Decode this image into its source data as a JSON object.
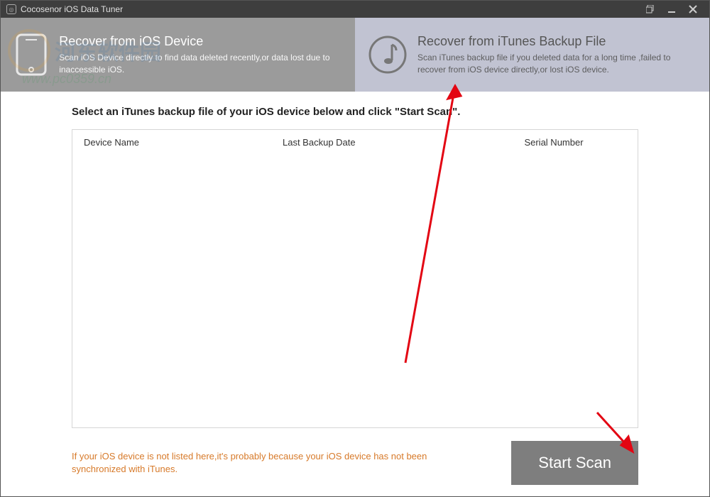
{
  "titlebar": {
    "title": "Cocosenor iOS Data Tuner"
  },
  "tabs": {
    "device": {
      "title": "Recover from iOS Device",
      "desc": "Scan iOS Device directly to find data deleted recently,or data lost due to inaccessible iOS."
    },
    "itunes": {
      "title": "Recover from iTunes Backup File",
      "desc": "Scan iTunes backup file if you deleted data for a long time ,failed to recover from iOS device directly,or lost iOS device."
    }
  },
  "instruction": "Select an iTunes backup file of your iOS device below and click \"Start Scan\".",
  "columns": {
    "name": "Device Name",
    "date": "Last Backup Date",
    "serial": "Serial Number"
  },
  "rows": [],
  "note": "If your iOS device is not listed here,it's probably because your iOS device has not been synchronized with iTunes.",
  "start_btn": "Start Scan",
  "watermark": {
    "site_name": "河东软件园",
    "url": "www.pc0359.cn"
  }
}
